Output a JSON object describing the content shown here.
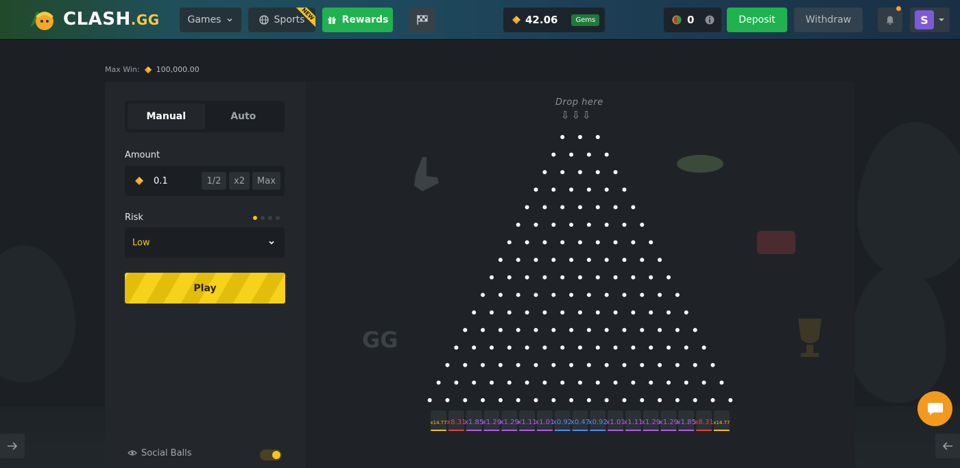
{
  "header": {
    "logo_text": "CLASH",
    "logo_suffix": ".GG",
    "nav": {
      "games_label": "Games",
      "sports_label": "Sports",
      "sports_badge": "NEW",
      "rewards_label": "Rewards"
    },
    "balance": {
      "amount": "42.06",
      "currency_label": "Gems"
    },
    "coins": {
      "amount": "0"
    },
    "deposit_label": "Deposit",
    "withdraw_label": "Withdraw",
    "avatar_letter": "S"
  },
  "game": {
    "max_win_label": "Max Win:",
    "max_win_value": "100,000.00",
    "tabs": [
      "Manual",
      "Auto"
    ],
    "active_tab": "Manual",
    "amount_label": "Amount",
    "amount_value": "0.1",
    "amount_buttons": [
      "1/2",
      "x2",
      "Max"
    ],
    "risk_label": "Risk",
    "risk_value": "Low",
    "risk_level": 1,
    "risk_levels_total": 4,
    "play_label": "Play",
    "social_balls_label": "Social Balls",
    "social_balls_enabled": true
  },
  "board": {
    "drop_label": "Drop here",
    "rows": 16,
    "multipliers": [
      "x14.77",
      "x8.31",
      "x1.85",
      "x1.29",
      "x1.29",
      "x1.11",
      "x1.01",
      "x0.92",
      "x0.47",
      "x0.92",
      "x1.01",
      "x1.11",
      "x1.29",
      "x1.29",
      "x1.85",
      "x8.31",
      "x14.77"
    ],
    "multiplier_colors": [
      "#f5c518",
      "#e8453c",
      "#b45cf0",
      "#b45cf0",
      "#b45cf0",
      "#b45cf0",
      "#b45cf0",
      "#4d8ff5",
      "#4d8ff5",
      "#4d8ff5",
      "#b45cf0",
      "#b45cf0",
      "#b45cf0",
      "#b45cf0",
      "#b45cf0",
      "#e8453c",
      "#f5c518"
    ]
  },
  "colors": {
    "accent_green": "#1fb24f",
    "accent_yellow": "#f5c518",
    "chat_orange": "#f39a1d"
  }
}
